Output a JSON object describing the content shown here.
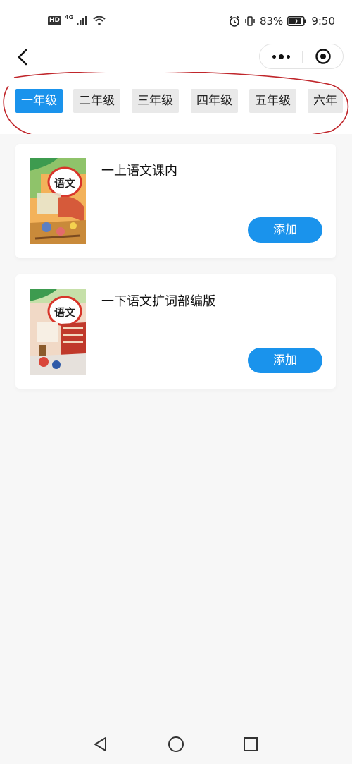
{
  "status_bar": {
    "hd_badge": "HD",
    "network": "4G",
    "battery": "83%",
    "time": "9:50",
    "icons": [
      "signal-icon",
      "wifi-icon",
      "alarm-icon",
      "vibrate-icon",
      "battery-icon"
    ]
  },
  "nav": {
    "back_icon": "chevron-left-icon",
    "more_icon": "more-dots-icon",
    "close_icon": "target-circle-icon"
  },
  "grades": {
    "active_index": 0,
    "tabs": [
      "一年级",
      "二年级",
      "三年级",
      "四年级",
      "五年级",
      "六年"
    ]
  },
  "books": [
    {
      "title": "一上语文课内",
      "button_label": "添加",
      "cover_icon": "textbook-cover-yuwen-1a"
    },
    {
      "title": "一下语文扩词部编版",
      "button_label": "添加",
      "cover_icon": "textbook-cover-yuwen-1b"
    }
  ],
  "colors": {
    "accent": "#1a93ec",
    "annotation": "#c0262b",
    "tab_inactive_bg": "#e9e9e9",
    "page_bg": "#f7f7f7"
  },
  "system_nav": {
    "icons": [
      "back-triangle-icon",
      "home-circle-icon",
      "recents-square-icon"
    ]
  }
}
